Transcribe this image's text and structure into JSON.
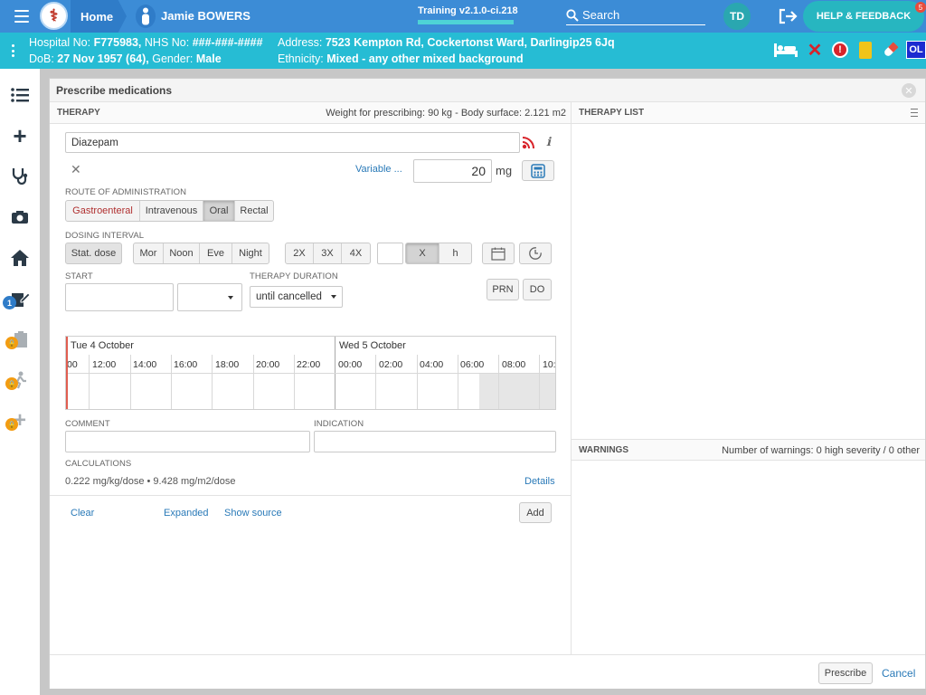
{
  "topbar": {
    "home_label": "Home",
    "patient_name": "Jamie BOWERS",
    "training_label": "Training v2.1.0-ci.218",
    "search_label": "Search",
    "avatar_initials": "TD",
    "help_label": "HELP & FEEDBACK",
    "help_badge": "5"
  },
  "banner": {
    "hospital_no_label": "Hospital No:",
    "hospital_no": "F775983,",
    "nhs_no_label": "NHS No:",
    "nhs_no": "###-###-####",
    "address_label": "Address:",
    "address": "7523 Kempton Rd, Cockertonst Ward, Darlingip25 6Jq",
    "dob_label": "DoB:",
    "dob": "27 Nov 1957 (64),",
    "gender_label": "Gender:",
    "gender": "Male",
    "ethnicity_label": "Ethnicity:",
    "ethnicity": "Mixed - any other mixed background",
    "ol_badge": "OL"
  },
  "sidebar": {
    "notification_badge": "1"
  },
  "modal": {
    "title": "Prescribe medications",
    "therapy_section": "THERAPY",
    "weight_info": "Weight for prescribing: 90 kg - Body surface: 2.121 m2",
    "therapy_list_section": "THERAPY LIST",
    "medication_name": "Diazepam",
    "variable_link": "Variable ...",
    "dose_value": "20",
    "dose_unit": "mg",
    "route_label": "ROUTE OF ADMINISTRATION",
    "routes": [
      "Gastroenteral",
      "Intravenous",
      "Oral",
      "Rectal"
    ],
    "selected_route": "Oral",
    "dosing_label": "DOSING INTERVAL",
    "stat_dose": "Stat. dose",
    "times_of_day": [
      "Mor",
      "Noon",
      "Eve",
      "Night"
    ],
    "multipliers": [
      "2X",
      "3X",
      "4X"
    ],
    "interval_unit_x": "X",
    "interval_unit_h": "h",
    "start_label": "START",
    "duration_label": "THERAPY DURATION",
    "duration_value": "until cancelled",
    "prn_label": "PRN",
    "do_label": "DO",
    "timeline_day1": "Tue 4 October",
    "timeline_day2": "Wed 5 October",
    "timeline_hours": [
      "00",
      "12:00",
      "14:00",
      "16:00",
      "18:00",
      "20:00",
      "22:00",
      "00:00",
      "02:00",
      "04:00",
      "06:00",
      "08:00",
      "10:"
    ],
    "comment_label": "COMMENT",
    "indication_label": "INDICATION",
    "calculations_label": "CALCULATIONS",
    "calculations_value": "0.222 mg/kg/dose • 9.428 mg/m2/dose",
    "details_link": "Details",
    "clear_link": "Clear",
    "expanded_link": "Expanded",
    "show_source_link": "Show source",
    "add_button": "Add",
    "warnings_section": "WARNINGS",
    "warnings_info": "Number of warnings: 0 high severity / 0 other",
    "prescribe_button": "Prescribe",
    "cancel_link": "Cancel"
  }
}
